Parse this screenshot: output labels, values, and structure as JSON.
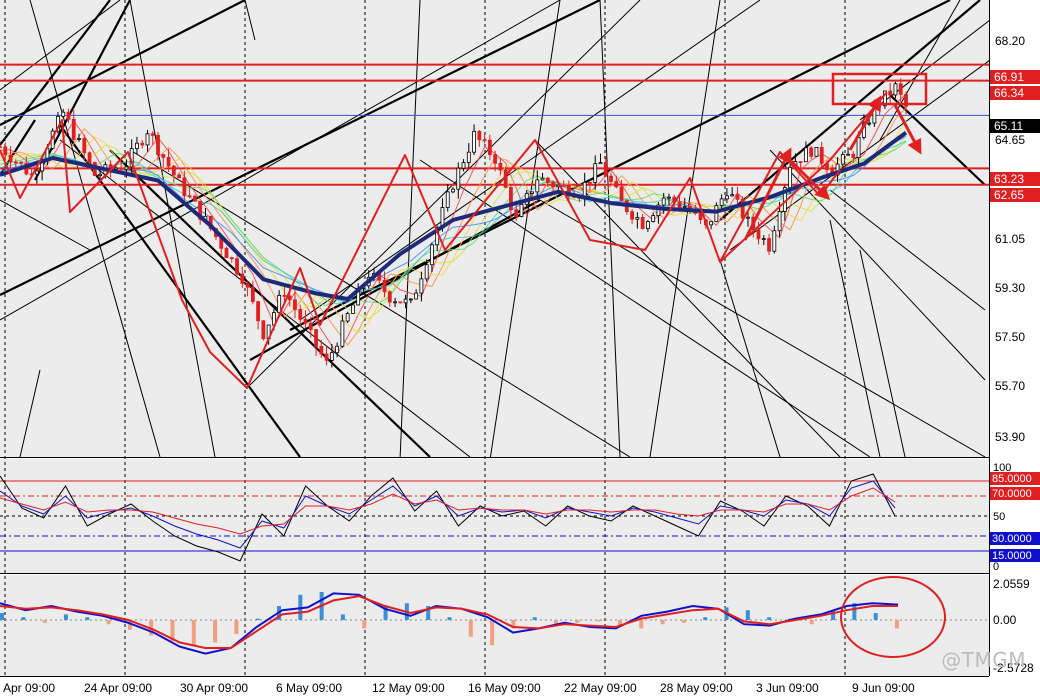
{
  "chart_data": [
    {
      "panel": "price",
      "type": "candlestick",
      "title": "",
      "ylim": [
        53.0,
        69.2
      ],
      "y_ticks": [
        "68.20",
        "64.65",
        "61.05",
        "59.30",
        "57.50",
        "55.70",
        "53.90"
      ],
      "price_tags": [
        {
          "label": "66.91",
          "value": 66.91,
          "color": "#e02020"
        },
        {
          "label": "66.34",
          "value": 66.34,
          "color": "#e02020"
        },
        {
          "label": "65.11",
          "value": 65.11,
          "color": "#000000"
        },
        {
          "label": "63.23",
          "value": 63.23,
          "color": "#e02020"
        },
        {
          "label": "62.65",
          "value": 62.65,
          "color": "#e02020"
        }
      ],
      "horizontal_lines": [
        66.91,
        66.34,
        65.11,
        63.23,
        62.65
      ],
      "grid": true,
      "approx_close_path": [
        [
          0,
          64.0
        ],
        [
          3,
          63.0
        ],
        [
          6,
          65.2
        ],
        [
          9,
          63.0
        ],
        [
          12,
          63.4
        ],
        [
          14,
          64.6
        ],
        [
          17,
          62.7
        ],
        [
          20,
          61.1
        ],
        [
          23,
          59.4
        ],
        [
          25,
          57.4
        ],
        [
          27,
          58.9
        ],
        [
          29,
          57.6
        ],
        [
          31,
          56.3
        ],
        [
          33,
          58.0
        ],
        [
          35,
          59.5
        ],
        [
          37,
          58.7
        ],
        [
          39,
          58.4
        ],
        [
          41,
          60.6
        ],
        [
          43,
          62.7
        ],
        [
          45,
          64.4
        ],
        [
          47,
          63.6
        ],
        [
          49,
          61.4
        ],
        [
          51,
          62.9
        ],
        [
          53,
          62.6
        ],
        [
          55,
          62.4
        ],
        [
          57,
          63.4
        ],
        [
          59,
          62.0
        ],
        [
          61,
          61.3
        ],
        [
          63,
          62.2
        ],
        [
          65,
          61.9
        ],
        [
          67,
          61.1
        ],
        [
          69,
          62.5
        ],
        [
          71,
          61.3
        ],
        [
          73,
          60.5
        ],
        [
          75,
          63.4
        ],
        [
          77,
          63.9
        ],
        [
          79,
          63.2
        ],
        [
          81,
          63.8
        ],
        [
          83,
          65.4
        ],
        [
          85,
          66.1
        ],
        [
          86,
          65.4
        ]
      ],
      "moving_average_path": [
        [
          0,
          63.0
        ],
        [
          5,
          63.6
        ],
        [
          10,
          63.2
        ],
        [
          15,
          62.8
        ],
        [
          20,
          61.2
        ],
        [
          25,
          59.3
        ],
        [
          30,
          58.8
        ],
        [
          33,
          58.6
        ],
        [
          38,
          60.2
        ],
        [
          43,
          61.4
        ],
        [
          48,
          61.9
        ],
        [
          53,
          62.4
        ],
        [
          58,
          62.0
        ],
        [
          63,
          61.8
        ],
        [
          68,
          61.7
        ],
        [
          73,
          62.2
        ],
        [
          78,
          62.9
        ],
        [
          82,
          63.4
        ],
        [
          86,
          64.5
        ]
      ]
    },
    {
      "panel": "oscillator",
      "type": "line",
      "title": "",
      "ylim": [
        0,
        100
      ],
      "y_ticks": [
        "100",
        "50",
        "0"
      ],
      "levels": [
        {
          "label": "85.0000",
          "value": 85,
          "color": "#e02020"
        },
        {
          "label": "70.0000",
          "value": 70,
          "color": "#e02020"
        },
        {
          "label": "30.0000",
          "value": 30,
          "color": "#1010cc"
        },
        {
          "label": "15.0000",
          "value": 15,
          "color": "#1010cc"
        }
      ],
      "series": [
        {
          "color": "#000000",
          "values": [
            90,
            58,
            48,
            80,
            40,
            52,
            62,
            45,
            30,
            20,
            14,
            5,
            52,
            30,
            80,
            60,
            45,
            70,
            88,
            55,
            75,
            40,
            60,
            50,
            55,
            40,
            60,
            50,
            45,
            60,
            50,
            40,
            30,
            65,
            55,
            40,
            70,
            60,
            40,
            85,
            92,
            50
          ]
        },
        {
          "color": "#1010cc",
          "values": [
            75,
            60,
            52,
            70,
            48,
            54,
            58,
            50,
            40,
            32,
            26,
            18,
            45,
            38,
            70,
            60,
            52,
            66,
            80,
            60,
            70,
            50,
            58,
            54,
            56,
            48,
            58,
            54,
            50,
            58,
            54,
            48,
            42,
            60,
            56,
            50,
            66,
            62,
            50,
            78,
            85,
            58
          ]
        },
        {
          "color": "#e02020",
          "values": [
            68,
            62,
            56,
            64,
            54,
            56,
            56,
            54,
            48,
            42,
            38,
            32,
            40,
            42,
            60,
            60,
            56,
            62,
            72,
            62,
            66,
            56,
            58,
            56,
            56,
            52,
            56,
            56,
            54,
            56,
            56,
            52,
            50,
            56,
            56,
            54,
            62,
            62,
            56,
            70,
            78,
            64
          ]
        }
      ]
    },
    {
      "panel": "macd",
      "type": "bar",
      "title": "",
      "ylim": [
        -2.5728,
        2.0559
      ],
      "y_ticks": [
        "2.0559",
        "0.00",
        "-2.5728"
      ],
      "histogram": [
        0.25,
        0.1,
        -0.1,
        0.2,
        0.1,
        -0.15,
        -0.35,
        -0.55,
        -0.75,
        -0.9,
        -0.8,
        -0.5,
        0.05,
        0.5,
        0.9,
        1.0,
        0.2,
        -0.3,
        0.5,
        0.6,
        0.5,
        0.1,
        -0.6,
        -0.9,
        -0.3,
        0.1,
        -0.2,
        -0.1,
        -0.05,
        -0.2,
        -0.3,
        -0.15,
        -0.1,
        0.1,
        0.45,
        0.35,
        0.1,
        0.05,
        -0.15,
        0.35,
        0.6,
        0.25,
        -0.3
      ],
      "series": [
        {
          "color": "#1010cc",
          "values": [
            0.6,
            0.35,
            0.5,
            0.3,
            0.15,
            -0.1,
            -0.45,
            -0.95,
            -1.2,
            -1.0,
            -0.25,
            0.35,
            0.45,
            0.95,
            0.9,
            0.4,
            0.15,
            0.5,
            0.4,
            0.1,
            -0.45,
            -0.3,
            -0.1,
            -0.25,
            -0.3,
            0.15,
            0.3,
            0.5,
            0.4,
            -0.15,
            -0.2,
            0.05,
            0.2,
            0.5,
            0.6,
            0.55
          ]
        },
        {
          "color": "#e02020",
          "values": [
            0.5,
            0.4,
            0.45,
            0.35,
            0.2,
            0.0,
            -0.35,
            -0.8,
            -1.0,
            -1.0,
            -0.4,
            0.2,
            0.3,
            0.7,
            0.85,
            0.5,
            0.25,
            0.45,
            0.4,
            0.2,
            -0.25,
            -0.3,
            -0.15,
            -0.2,
            -0.25,
            0.05,
            0.2,
            0.35,
            0.4,
            -0.05,
            -0.15,
            0.0,
            0.15,
            0.35,
            0.5,
            0.5
          ]
        }
      ]
    }
  ],
  "x_axis": {
    "labels": [
      "Apr 09:00",
      "24 Apr 09:00",
      "30 Apr 09:00",
      "6 May 09:00",
      "12 May 09:00",
      "16 May 09:00",
      "22 May 09:00",
      "28 May 09:00",
      "3 Jun 09:00",
      "9 Jun 09:00"
    ]
  },
  "colors": {
    "background": "#ececec",
    "axis_background": "#ffffff",
    "bull_candle": "#000000",
    "bear_candle": "#e02020",
    "moving_average": "#1e2a78",
    "annotation": "#e02020",
    "histogram_positive": "#3a8fd8",
    "histogram_negative": "#f0a080"
  },
  "watermark": "@TMGM"
}
